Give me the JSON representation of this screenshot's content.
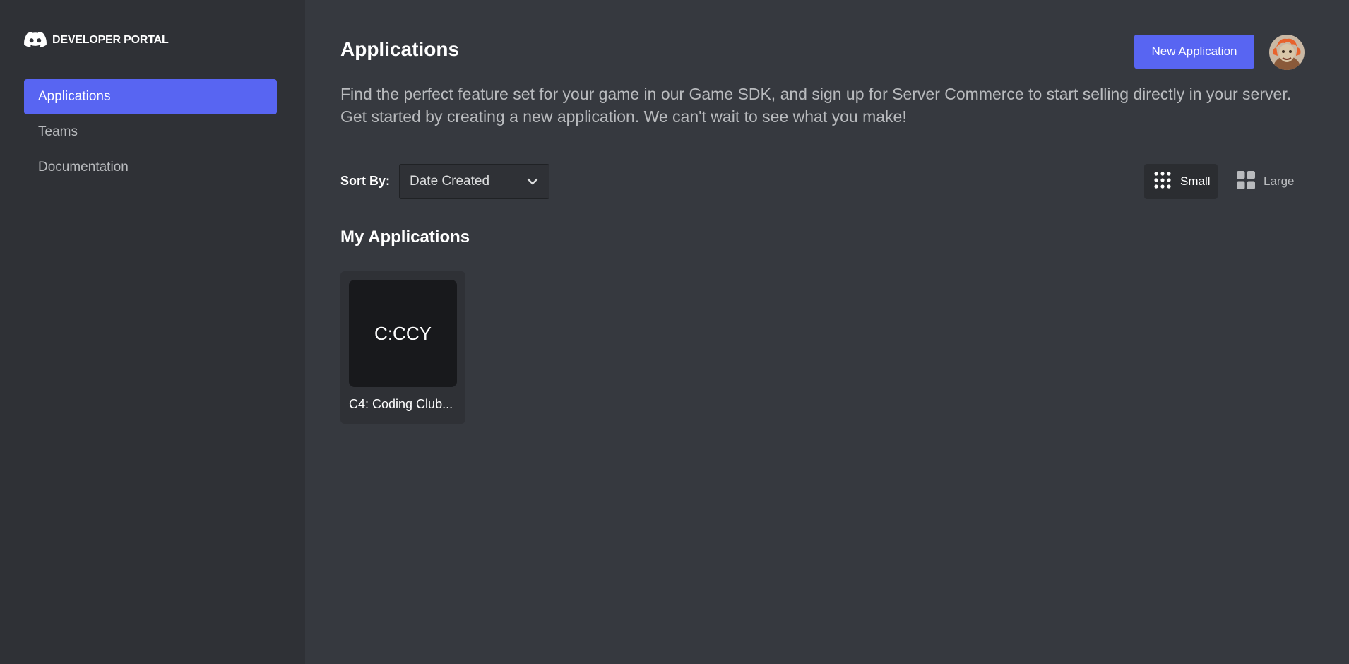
{
  "brand": {
    "title": "DEVELOPER PORTAL",
    "logo_icon": "discord-logo-icon"
  },
  "sidebar": {
    "items": [
      {
        "label": "Applications",
        "active": true
      },
      {
        "label": "Teams",
        "active": false
      },
      {
        "label": "Documentation",
        "active": false
      }
    ]
  },
  "header": {
    "title": "Applications",
    "new_app_label": "New Application",
    "avatar_icon": "user-avatar"
  },
  "description": {
    "line1": "Find the perfect feature set for your game in our Game SDK, and sign up for Server Commerce to start selling directly in your server.",
    "line2": "Get started by creating a new application. We can't wait to see what you make!"
  },
  "sort": {
    "label": "Sort By:",
    "selected": "Date Created"
  },
  "view_toggle": {
    "small_label": "Small",
    "large_label": "Large",
    "selected": "Small"
  },
  "section": {
    "title": "My Applications"
  },
  "applications": [
    {
      "icon_text": "C:CCY",
      "name": "C4: Coding Club..."
    }
  ],
  "colors": {
    "accent": "#5865f2",
    "background": "#36393f",
    "sidebar": "#2f3136"
  }
}
